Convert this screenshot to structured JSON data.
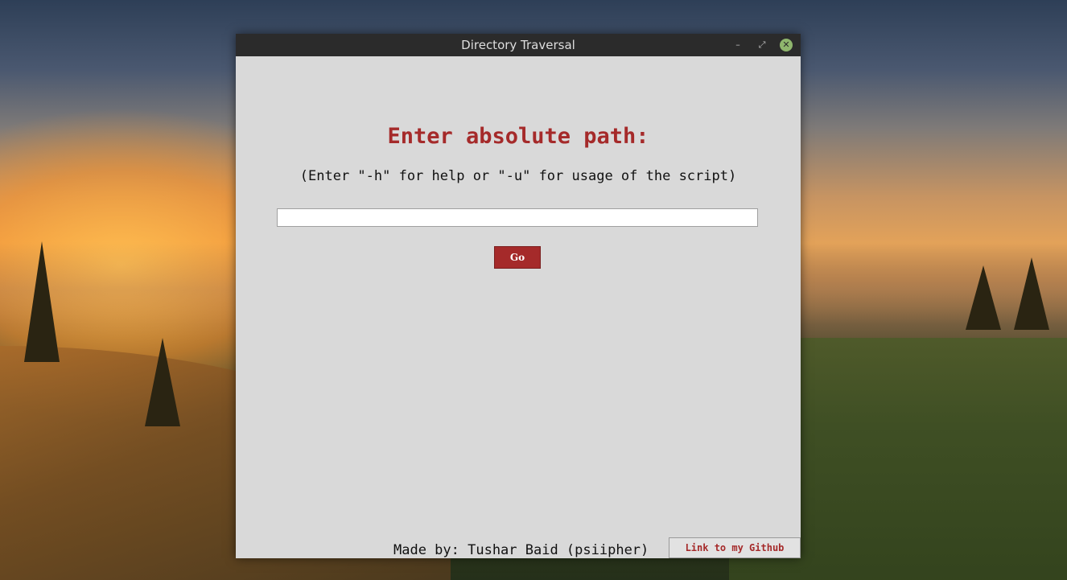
{
  "window": {
    "title": "Directory Traversal",
    "controls": {
      "minimize_icon": "–",
      "maximize_icon": "⤢",
      "close_icon": "✕"
    }
  },
  "main": {
    "heading": "Enter absolute path:",
    "subheading": "(Enter \"-h\" for help or \"-u\" for usage of the script)",
    "path_input": {
      "value": "",
      "placeholder": ""
    },
    "go_label": "Go"
  },
  "footer": {
    "credit": "Made by: Tushar Baid (psiipher)",
    "github_link_label": "Link to my Github"
  },
  "colors": {
    "accent": "#a52a2a",
    "window_bg": "#d9d9d9",
    "titlebar_bg": "#2b2b2b",
    "close_button": "#8fb66d"
  }
}
